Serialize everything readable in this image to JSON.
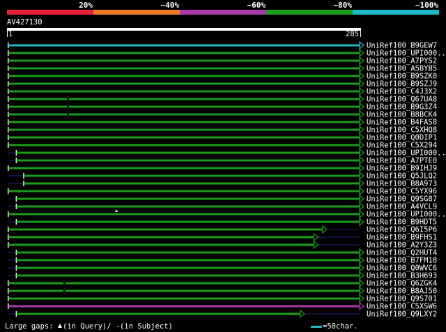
{
  "identity_scale": {
    "labels": [
      "20%",
      "~40%",
      "~60%",
      "~80%",
      "~100%"
    ],
    "colors": [
      "#e8203c",
      "#ee7a20",
      "#a83aa8",
      "#1a9e1a",
      "#20b8c8"
    ]
  },
  "query": {
    "id": "AV427130",
    "start": "1",
    "end": "285",
    "length": 285
  },
  "alignments": [
    {
      "name": "UniRef100_B9GEW7",
      "color": "#20b8c8",
      "start": 1,
      "end": 285,
      "tail": "arrow"
    },
    {
      "name": "UniRef100_UPI000..",
      "color": "#1a9e1a",
      "start": 1,
      "end": 285,
      "tail": "arrow"
    },
    {
      "name": "UniRef100_A7PYS2",
      "color": "#1a9e1a",
      "start": 1,
      "end": 285,
      "tail": "arrow"
    },
    {
      "name": "UniRef100_A5BYB5",
      "color": "#1a9e1a",
      "start": 1,
      "end": 285,
      "tail": "arrow"
    },
    {
      "name": "UniRef100_B9SZK0",
      "color": "#1a9e1a",
      "start": 1,
      "end": 285,
      "tail": "arrow"
    },
    {
      "name": "UniRef100_B9SZJ9",
      "color": "#1a9e1a",
      "start": 1,
      "end": 285,
      "tail": "arrow"
    },
    {
      "name": "UniRef100_C4J3X2",
      "color": "#1a9e1a",
      "start": 1,
      "end": 285,
      "tail": "arrow"
    },
    {
      "name": "UniRef100_Q67UA8",
      "color": "#1a9e1a",
      "start": 1,
      "end": 285,
      "tail": "arrow",
      "gap_at": 48
    },
    {
      "name": "UniRef100_B9G3Z4",
      "color": "#1a9e1a",
      "start": 1,
      "end": 285,
      "tail": "arrow",
      "gap_at": 48
    },
    {
      "name": "UniRef100_B8BCK4",
      "color": "#1a9e1a",
      "start": 1,
      "end": 285,
      "tail": "arrow",
      "gap_at": 48
    },
    {
      "name": "UniRef100_B4FAS8",
      "color": "#1a9e1a",
      "start": 1,
      "end": 285,
      "tail": "arrow"
    },
    {
      "name": "UniRef100_C5XHQ8",
      "color": "#1a9e1a",
      "start": 1,
      "end": 285,
      "tail": "arrow"
    },
    {
      "name": "UniRef100_Q0DIP1",
      "color": "#1a9e1a",
      "start": 1,
      "end": 285,
      "tail": "arrow"
    },
    {
      "name": "UniRef100_C5X294",
      "color": "#1a9e1a",
      "start": 1,
      "end": 285,
      "tail": "arrow"
    },
    {
      "name": "UniRef100_UPI000..",
      "color": "#1a9e1a",
      "start": 7,
      "end": 285,
      "tail": "arrow",
      "start_tick": true
    },
    {
      "name": "UniRef100_A7PTE0",
      "color": "#1a9e1a",
      "start": 7,
      "end": 285,
      "tail": "arrow",
      "start_tick": true
    },
    {
      "name": "UniRef100_B9IHJ9",
      "color": "#1a9e1a",
      "start": 1,
      "end": 285,
      "tail": "arrow"
    },
    {
      "name": "UniRef100_Q5JLQ2",
      "color": "#1a9e1a",
      "start": 13,
      "end": 285,
      "tail": "arrow",
      "start_tick": true
    },
    {
      "name": "UniRef100_B8A973",
      "color": "#1a9e1a",
      "start": 13,
      "end": 285,
      "tail": "arrow",
      "start_tick": true
    },
    {
      "name": "UniRef100_C5YX96",
      "color": "#1a9e1a",
      "start": 1,
      "end": 285,
      "tail": "arrow"
    },
    {
      "name": "UniRef100_Q9SG87",
      "color": "#1a9e1a",
      "start": 7,
      "end": 285,
      "tail": "arrow",
      "start_tick": true
    },
    {
      "name": "UniRef100_A4VCL9",
      "color": "#1a9e1a",
      "start": 7,
      "end": 285,
      "tail": "arrow",
      "start_tick": true
    },
    {
      "name": "UniRef100_UPI000..",
      "color": "#1a9e1a",
      "start": 1,
      "end": 285,
      "tail": "arrow",
      "query_gap_at": 88
    },
    {
      "name": "UniRef100_B9HDT5",
      "color": "#1a9e1a",
      "start": 7,
      "end": 285,
      "tail": "arrow",
      "start_tick": true
    },
    {
      "name": "UniRef100_Q6I5P6",
      "color": "#1a9e1a",
      "start": 1,
      "end": 255,
      "tail": "arrow"
    },
    {
      "name": "UniRef100_B9FHS1",
      "color": "#1a9e1a",
      "start": 1,
      "end": 248,
      "tail": "arrow"
    },
    {
      "name": "UniRef100_A2Y3Z3",
      "color": "#1a9e1a",
      "start": 1,
      "end": 248,
      "tail": "arrow"
    },
    {
      "name": "UniRef100_Q2HUT4",
      "color": "#1a9e1a",
      "start": 7,
      "end": 285,
      "tail": "arrow",
      "start_tick": true
    },
    {
      "name": "UniRef100_B7FM18",
      "color": "#1a9e1a",
      "start": 7,
      "end": 285,
      "tail": "arrow",
      "start_tick": true
    },
    {
      "name": "UniRef100_Q0WVC6",
      "color": "#1a9e1a",
      "start": 7,
      "end": 285,
      "tail": "arrow",
      "start_tick": true
    },
    {
      "name": "UniRef100_B3H693",
      "color": "#1a9e1a",
      "start": 7,
      "end": 285,
      "tail": "arrow",
      "start_tick": true
    },
    {
      "name": "UniRef100_Q6ZGK4",
      "color": "#1a9e1a",
      "start": 1,
      "end": 285,
      "tail": "arrow",
      "gap_at": 45
    },
    {
      "name": "UniRef100_B8AJ50",
      "color": "#1a9e1a",
      "start": 1,
      "end": 285,
      "tail": "arrow",
      "gap_at": 45
    },
    {
      "name": "UniRef100_Q9S701",
      "color": "#1a9e1a",
      "start": 1,
      "end": 285,
      "tail": "arrow"
    },
    {
      "name": "UniRef100_C5XSW6",
      "color": "#a83aa8",
      "start": 1,
      "end": 285,
      "tail": "arrow"
    },
    {
      "name": "UniRef100_Q9LXY2",
      "color": "#1a9e1a",
      "start": 7,
      "end": 237,
      "tail": "arrow",
      "start_tick": true
    }
  ],
  "legend": {
    "large_gaps_label": "Large gaps:",
    "query_gap_text": "(in Query)/",
    "subject_gap_symbol": "-",
    "subject_gap_text": " (in Subject)",
    "scale_color": "#20b8c8",
    "scale_text": "=50char."
  }
}
